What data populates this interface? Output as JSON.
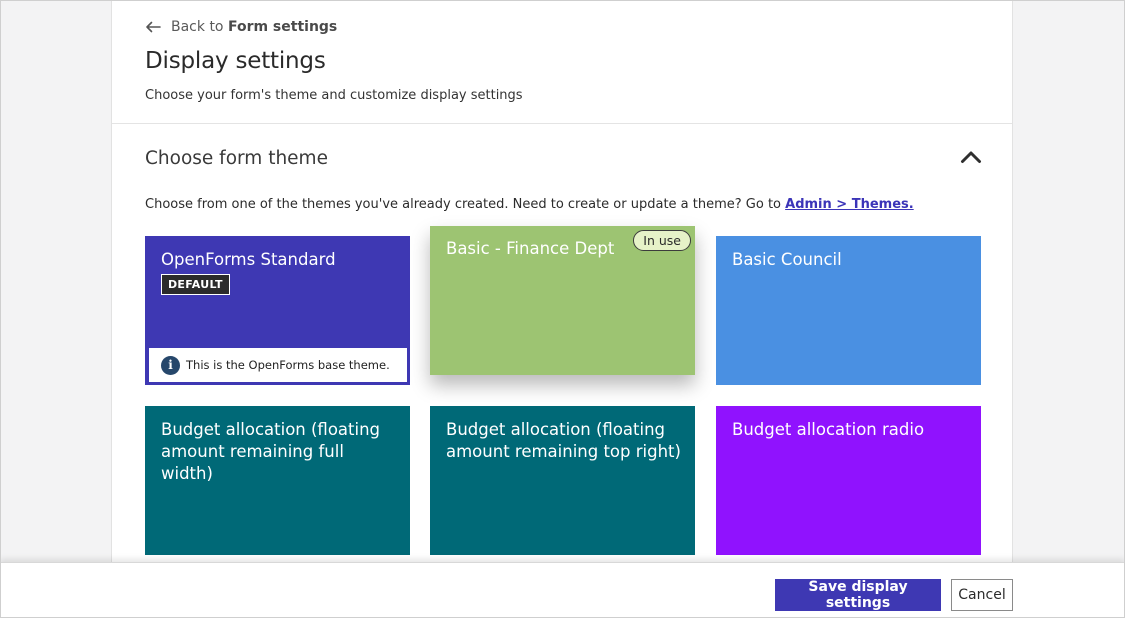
{
  "header": {
    "back_prefix": "Back to ",
    "back_target": "Form settings",
    "title": "Display settings",
    "subtitle": "Choose your form's theme and customize display settings"
  },
  "section": {
    "title": "Choose form theme",
    "helper_text": "Choose from one of the themes you've already created. Need to create or update a theme? Go to ",
    "helper_link": "Admin > Themes."
  },
  "themes": [
    {
      "name": "OpenForms Standard",
      "badge": "DEFAULT",
      "note": "This is the OpenForms base theme.",
      "color": "#3e38b3"
    },
    {
      "name": "Basic - Finance Dept",
      "status": "In use",
      "color": "#9dc472"
    },
    {
      "name": "Basic Council",
      "color": "#4a90e2"
    },
    {
      "name": "Budget allocation (floating amount remaining full width)",
      "color": "#006977"
    },
    {
      "name": "Budget allocation (floating amount remaining top right)",
      "color": "#006977"
    },
    {
      "name": "Budget allocation radio",
      "color": "#9012fe"
    }
  ],
  "footer": {
    "save_label": "Save display settings",
    "cancel_label": "Cancel"
  },
  "icons": {
    "back": "arrow-left-icon",
    "collapse": "chevron-up-icon",
    "info": "info-icon"
  },
  "colors": {
    "primary": "#3e38b3",
    "link": "#3b34b8"
  }
}
